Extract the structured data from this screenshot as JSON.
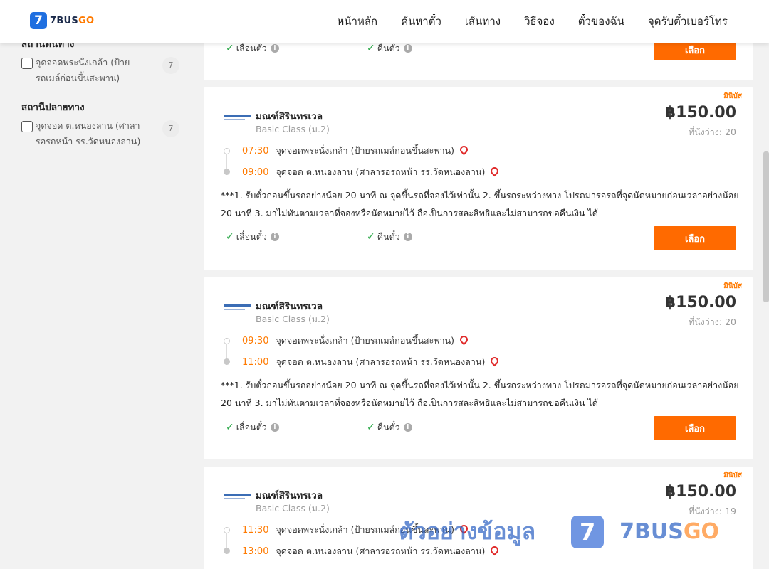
{
  "header": {
    "logo_mark": "7",
    "logo_text_main": "7BUS",
    "logo_text_accent": "GO",
    "nav": [
      "หน้าหลัก",
      "ค้นหาตั๋ว",
      "เส้นทาง",
      "วิธีจอง",
      "ตั๋วของฉัน",
      "จุดรับตั๋วเบอร์โทร"
    ]
  },
  "sidebar": {
    "origin_title": "สถานีต้นทาง",
    "origin_filter": {
      "label": "จุดจอดพระนั่งเกล้า (ป้ายรถเมล์ก่อนขึ้นสะพาน)",
      "count": "7"
    },
    "destination_title": "สถานีปลายทาง",
    "destination_filter": {
      "label": "จุดจอด ต.หนองลาน (ศาลารอรถหน้า รร.วัดหนองลาน)",
      "count": "7"
    }
  },
  "common": {
    "bus_type": "มินิบัส",
    "operator": "มณฑ์สิรินทรเวล",
    "class": "Basic Class (ม.2)",
    "origin_stop": "จุดจอดพระนั่งเกล้า (ป้ายรถเมล์ก่อนขึ้นสะพาน)",
    "destination_stop": "จุดจอด ต.หนองลาน (ศาลารอรถหน้า รร.วัดหนองลาน)",
    "note": "***1. รับตั๋วก่อนขึ้นรถอย่างน้อย 20 นาที ณ จุดขึ้นรถที่จองไว้เท่านั้น 2. ขึ้นรถระหว่างทาง โปรดมารอรถที่จุดนัดหมายก่อนเวลาอย่างน้อย 20 นาที 3. มาไม่ทันตามเวลาที่จองหรือนัดหมายไว้ ถือเป็นการสละสิทธิและไม่สามารถขอคืนเงิน ได้",
    "reschedule": "เลื่อนตั๋ว",
    "refund": "คืนตั๋ว",
    "select": "เลือก",
    "info": "i"
  },
  "trips": [
    {
      "price": "฿150.00",
      "seats": "ที่นั่งว่าง: 20",
      "depart": "07:30",
      "arrive": "09:00"
    },
    {
      "price": "฿150.00",
      "seats": "ที่นั่งว่าง: 20",
      "depart": "09:30",
      "arrive": "11:00"
    },
    {
      "price": "฿150.00",
      "seats": "ที่นั่งว่าง: 19",
      "depart": "11:30",
      "arrive": "13:00"
    }
  ],
  "watermark": {
    "text": "ตัวอย่างข้อมูล",
    "logo": "7",
    "brand_main": "7BUS",
    "brand_accent": "GO"
  },
  "colors": {
    "accent": "#ff6a00",
    "brand_blue": "#1f6fe0",
    "check_green": "#27a745",
    "pin_red": "#e02b2b"
  }
}
